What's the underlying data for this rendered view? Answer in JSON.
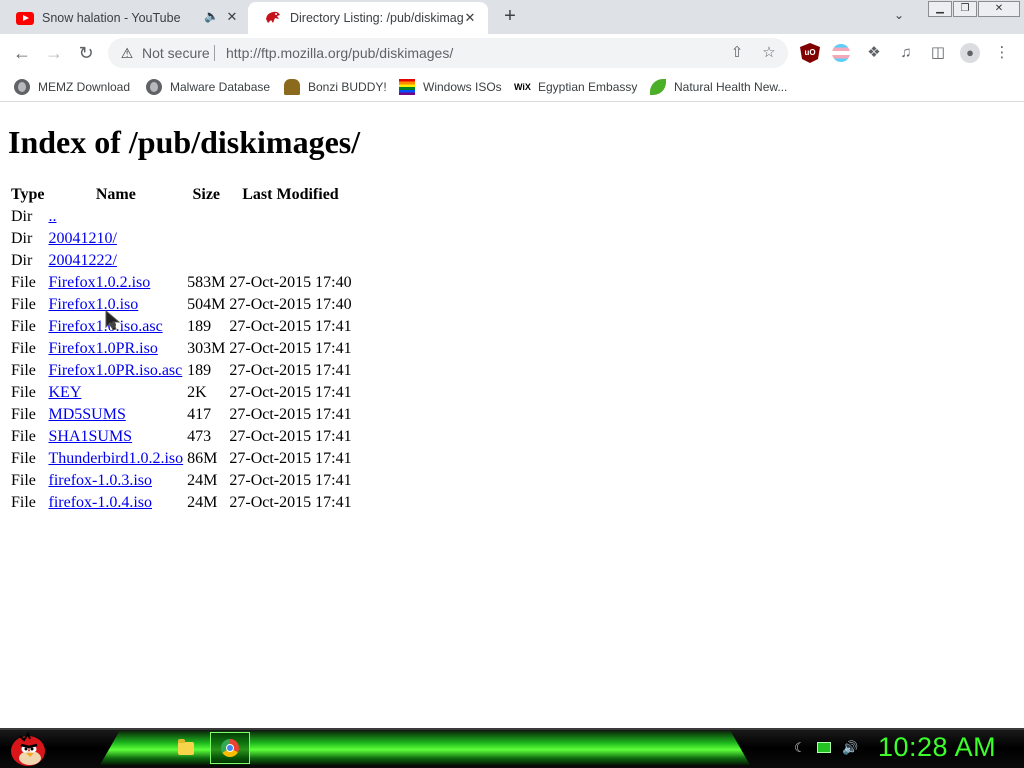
{
  "browser": {
    "tabs": [
      {
        "title": "Snow halation - YouTube",
        "icon": "youtube-icon",
        "audio": "speaker-muted-icon"
      },
      {
        "title": "Directory Listing: /pub/diskimag",
        "icon": "mozilla-dino-icon"
      }
    ],
    "new_tab_label": "+",
    "security_label": "Not secure",
    "url_host": "http://ftp.mozilla.org",
    "url_path": "/pub/diskimages/",
    "bookmarks": [
      {
        "label": "MEMZ Download",
        "icon": "globe-icon"
      },
      {
        "label": "Malware Database",
        "icon": "globe-icon"
      },
      {
        "label": "Bonzi BUDDY!",
        "icon": "bonzi-icon"
      },
      {
        "label": "Windows ISOs",
        "icon": "rainbow-flag-icon"
      },
      {
        "label": "Egyptian Embassy",
        "icon": "wix-icon"
      },
      {
        "label": "Natural Health New...",
        "icon": "leaf-icon"
      }
    ]
  },
  "page": {
    "heading": "Index of /pub/diskimages/",
    "columns": [
      "Type",
      "Name",
      "Size",
      "Last Modified"
    ],
    "rows": [
      {
        "type": "Dir",
        "name": "..",
        "size": "",
        "modified": ""
      },
      {
        "type": "Dir",
        "name": "20041210/",
        "size": "",
        "modified": ""
      },
      {
        "type": "Dir",
        "name": "20041222/",
        "size": "",
        "modified": ""
      },
      {
        "type": "File",
        "name": "Firefox1.0.2.iso",
        "size": "583M",
        "modified": "27-Oct-2015 17:40"
      },
      {
        "type": "File",
        "name": "Firefox1.0.iso",
        "size": "504M",
        "modified": "27-Oct-2015 17:40"
      },
      {
        "type": "File",
        "name": "Firefox1.0.iso.asc",
        "size": "189",
        "modified": "27-Oct-2015 17:41"
      },
      {
        "type": "File",
        "name": "Firefox1.0PR.iso",
        "size": "303M",
        "modified": "27-Oct-2015 17:41"
      },
      {
        "type": "File",
        "name": "Firefox1.0PR.iso.asc",
        "size": "189",
        "modified": "27-Oct-2015 17:41"
      },
      {
        "type": "File",
        "name": "KEY",
        "size": "2K",
        "modified": "27-Oct-2015 17:41"
      },
      {
        "type": "File",
        "name": "MD5SUMS",
        "size": "417",
        "modified": "27-Oct-2015 17:41"
      },
      {
        "type": "File",
        "name": "SHA1SUMS",
        "size": "473",
        "modified": "27-Oct-2015 17:41"
      },
      {
        "type": "File",
        "name": "Thunderbird1.0.2.iso",
        "size": "86M",
        "modified": "27-Oct-2015 17:41"
      },
      {
        "type": "File",
        "name": "firefox-1.0.3.iso",
        "size": "24M",
        "modified": "27-Oct-2015 17:41"
      },
      {
        "type": "File",
        "name": "firefox-1.0.4.iso",
        "size": "24M",
        "modified": "27-Oct-2015 17:41"
      }
    ]
  },
  "taskbar": {
    "clock": "10:28 AM",
    "apps": [
      "folder-icon",
      "chrome-icon"
    ],
    "glow_color": "#3cff2a"
  },
  "colors": {
    "link": "#0000ee",
    "tabbar": "#dee1e6"
  }
}
